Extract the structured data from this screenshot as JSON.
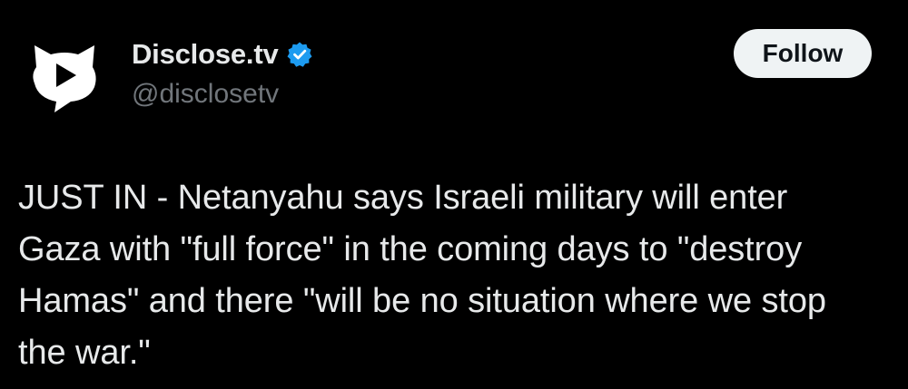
{
  "author": {
    "display_name": "Disclose.tv",
    "handle": "@disclosetv",
    "verified": true,
    "avatar_icon": "disclose-tv-logo-icon",
    "verified_icon": "verified-badge-icon",
    "verified_color": "#1d9bf0"
  },
  "actions": {
    "follow_label": "Follow"
  },
  "tweet": {
    "text": "JUST IN - Netanyahu says Israeli military will enter\nGaza with \"full force\" in the coming days to \"destroy\nHamas\" and there \"will be no situation where we stop\nthe war.\""
  },
  "colors": {
    "background": "#000000",
    "primary_text": "#e7e9ea",
    "secondary_text": "#71767b",
    "follow_button_bg": "#eff3f4",
    "follow_button_text": "#0f1419"
  }
}
